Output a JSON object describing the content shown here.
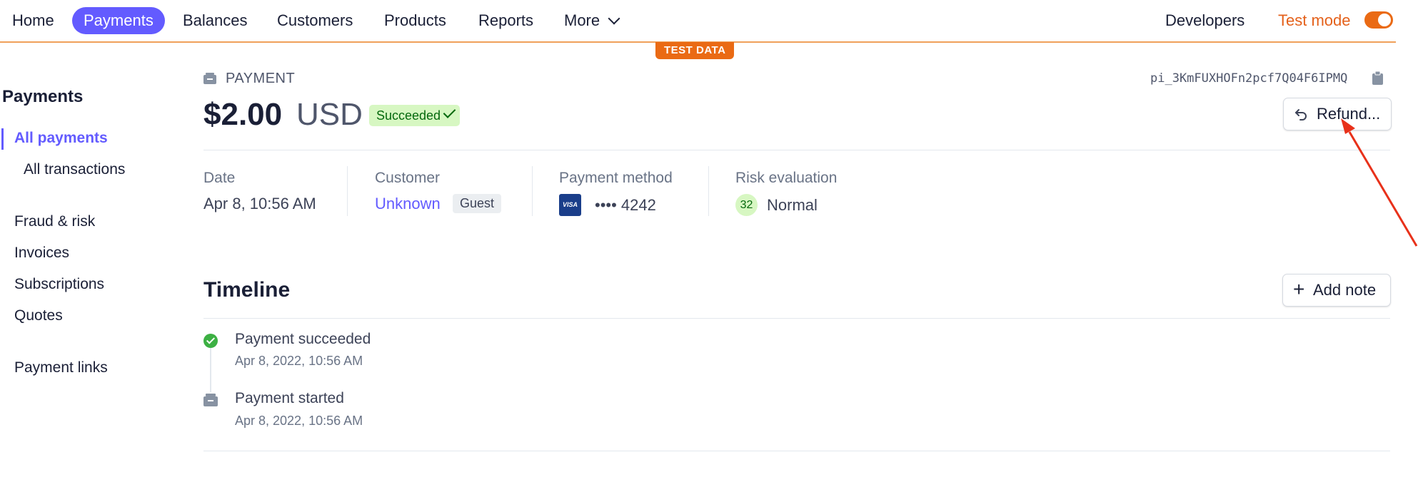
{
  "nav": {
    "items": [
      "Home",
      "Payments",
      "Balances",
      "Customers",
      "Products",
      "Reports",
      "More"
    ],
    "active": "Payments",
    "developers": "Developers",
    "test_mode_label": "Test mode",
    "test_mode_on": true,
    "test_data_badge": "TEST DATA"
  },
  "sidebar": {
    "title": "Payments",
    "items": [
      "All payments",
      "All transactions",
      "Fraud & risk",
      "Invoices",
      "Subscriptions",
      "Quotes",
      "Payment links"
    ],
    "active": "All payments"
  },
  "payment": {
    "label": "PAYMENT",
    "amount": "$2.00",
    "currency": "USD",
    "status": "Succeeded",
    "id": "pi_3KmFUXHOFn2pcf7Q04F6IPMQ",
    "refund_label": "Refund..."
  },
  "details": {
    "date_label": "Date",
    "date_value": "Apr 8, 10:56 AM",
    "customer_label": "Customer",
    "customer_value": "Unknown",
    "customer_badge": "Guest",
    "method_label": "Payment method",
    "card_brand": "VISA",
    "card_last4": "•••• 4242",
    "risk_label": "Risk evaluation",
    "risk_score": "32",
    "risk_level": "Normal"
  },
  "timeline": {
    "title": "Timeline",
    "add_note_label": "Add note",
    "events": [
      {
        "title": "Payment succeeded",
        "time": "Apr 8, 2022, 10:56 AM"
      },
      {
        "title": "Payment started",
        "time": "Apr 8, 2022, 10:56 AM"
      }
    ]
  },
  "colors": {
    "accent": "#635bff",
    "test_mode": "#ea6a14",
    "success_bg": "#d7f7c2",
    "success_text": "#05690d",
    "annotation_arrow": "#e8311a"
  }
}
